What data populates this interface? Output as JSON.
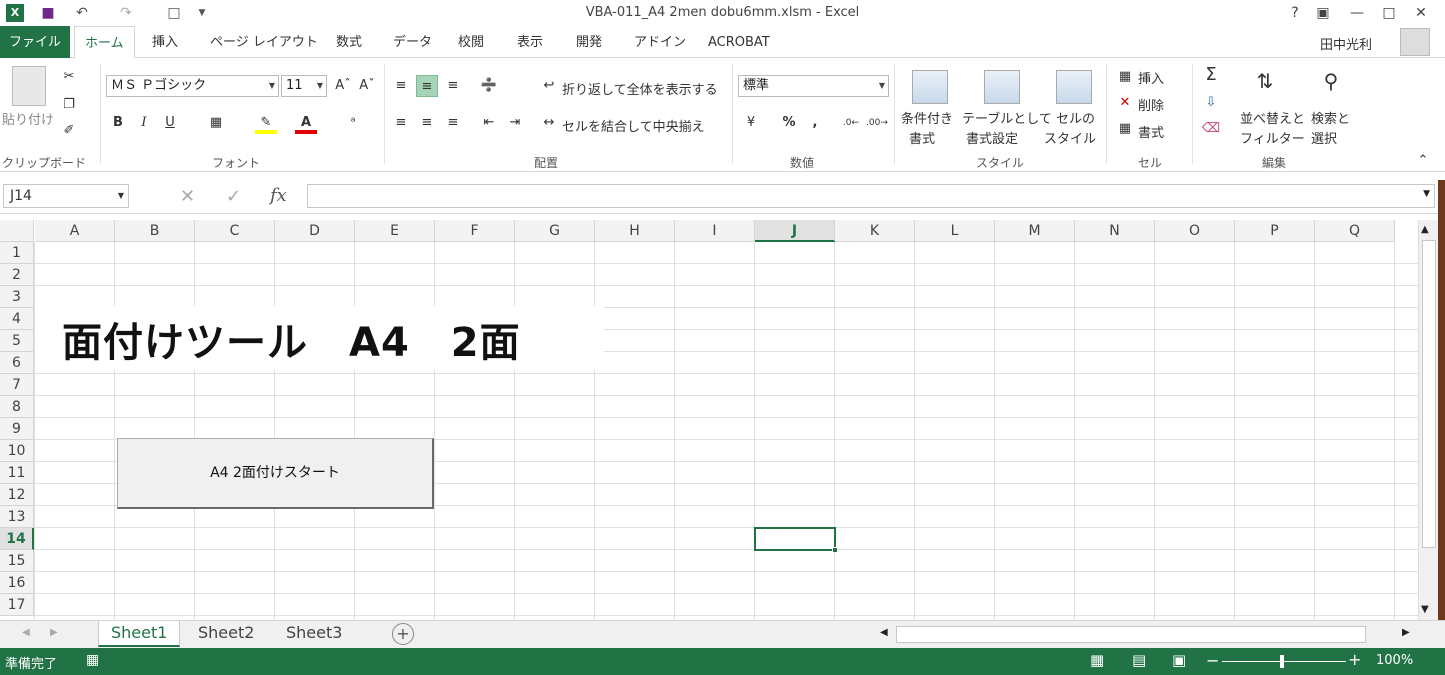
{
  "window": {
    "title": "VBA-011_A4 2men dobu6mm.xlsm - Excel",
    "help": "?",
    "user": "田中光利"
  },
  "tabs": [
    "ファイル",
    "ホーム",
    "挿入",
    "ページ レイアウト",
    "数式",
    "データ",
    "校閲",
    "表示",
    "開発",
    "アドイン",
    "ACROBAT"
  ],
  "ribbon": {
    "clipboard": {
      "paste": "貼り付け",
      "group": "クリップボード"
    },
    "font": {
      "name": "ＭＳ Ｐゴシック",
      "size": "11",
      "bold": "B",
      "italic": "I",
      "underline": "U",
      "group": "フォント"
    },
    "alignment": {
      "wrap": "折り返して全体を表示する",
      "merge": "セルを結合して中央揃え",
      "group": "配置"
    },
    "number": {
      "format": "標準",
      "percent": "%",
      "comma": ",",
      "group": "数値"
    },
    "styles": {
      "cond1": "条件付き",
      "cond2": "書式",
      "table1": "テーブルとして",
      "table2": "書式設定",
      "cell1": "セルの",
      "cell2": "スタイル",
      "group": "スタイル"
    },
    "cells": {
      "insert": "挿入",
      "delete": "削除",
      "format": "書式",
      "group": "セル"
    },
    "editing": {
      "sum": "Σ",
      "sort1": "並べ替えと",
      "sort2": "フィルター",
      "find1": "検索と",
      "find2": "選択",
      "group": "編集"
    }
  },
  "formula_bar": {
    "namebox": "J14",
    "fx": "fx"
  },
  "columns": [
    "A",
    "B",
    "C",
    "D",
    "E",
    "F",
    "G",
    "H",
    "I",
    "J",
    "K",
    "L",
    "M",
    "N",
    "O",
    "P",
    "Q"
  ],
  "rows": [
    "1",
    "2",
    "3",
    "4",
    "5",
    "6",
    "7",
    "8",
    "9",
    "10",
    "11",
    "12",
    "13",
    "14",
    "15",
    "16",
    "17"
  ],
  "selected": {
    "column": "J",
    "row": "14"
  },
  "sheet": {
    "title_text": "面付けツール　A4　2面",
    "button_label": "A4 2面付けスタート"
  },
  "sheet_tabs": [
    "Sheet1",
    "Sheet2",
    "Sheet3"
  ],
  "status": {
    "text": "準備完了",
    "zoom": "100%"
  }
}
